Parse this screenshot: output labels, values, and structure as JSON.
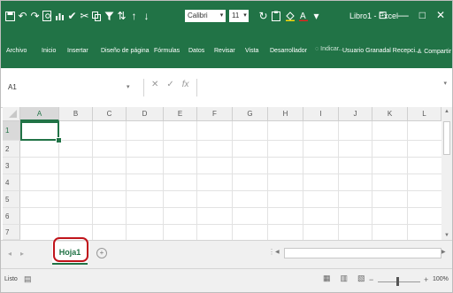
{
  "window": {
    "title": "Libro1 - Excel",
    "minimize_label": "—",
    "restore_label": "□",
    "close_label": "✕",
    "ribbon_options_label": "⊡"
  },
  "quick_access": {
    "font_name": "Calibri",
    "font_size": "11",
    "font_dropdown": "▾",
    "size_dropdown": "▾"
  },
  "ribbon": {
    "tabs": [
      "Archivo",
      "Inicio",
      "Insertar",
      "Diseño de página",
      "Fórmulas",
      "Datos",
      "Revisar",
      "Vista",
      "Desarrollador"
    ],
    "tell_me": "Indicar...",
    "tell_me_icon": "◌",
    "user": "Usuario Granadal Recepci...",
    "share_label": "Compartir",
    "share_icon": "♙"
  },
  "formula_bar": {
    "name_box": "A1",
    "name_dropdown": "▾",
    "cancel_icon": "✕",
    "enter_icon": "✓",
    "fx_label": "fx",
    "value": "",
    "expand_dropdown": "▾"
  },
  "grid": {
    "columns": [
      "A",
      "B",
      "C",
      "D",
      "E",
      "F",
      "G",
      "H",
      "I",
      "J",
      "K",
      "L"
    ],
    "rows": [
      "1",
      "2",
      "3",
      "4",
      "5",
      "6",
      "7"
    ],
    "selected_cell": "A1"
  },
  "sheets": {
    "tabs": [
      "Hoja1"
    ],
    "active": "Hoja1",
    "add_label": "+",
    "nav_prev": "◂",
    "nav_next": "▸",
    "dots": "⋮"
  },
  "status": {
    "ready_label": "Listo",
    "macro_icon": "▤",
    "zoom": "100%",
    "zoom_minus": "−",
    "zoom_plus": "+",
    "view_normal": "▦",
    "view_layout": "▥",
    "view_pagebreak": "▧"
  },
  "colors": {
    "accent": "#217346",
    "highlight": "#c0141b"
  }
}
